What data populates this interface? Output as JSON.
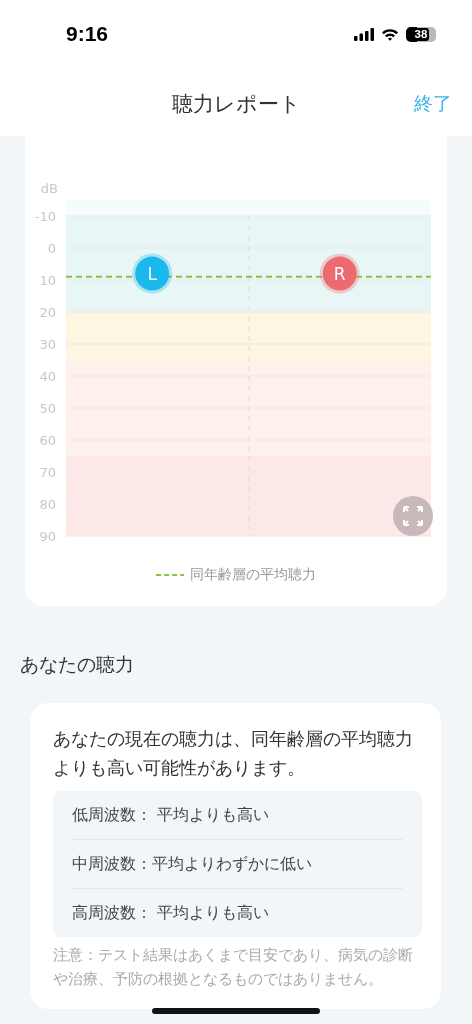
{
  "status_bar": {
    "time": "9:16",
    "battery": "38"
  },
  "header": {
    "title": "聴力レポート",
    "action": "終了"
  },
  "chart_card": {
    "chart_data": {
      "type": "scatter",
      "ylabel": "dB",
      "ylim": [
        90,
        -10
      ],
      "grid": true,
      "yticks": [
        -10,
        0,
        10,
        20,
        30,
        40,
        50,
        60,
        70,
        80,
        90
      ],
      "series": [
        {
          "name": "L",
          "color": "#1ab8ec",
          "values": [
            8
          ]
        },
        {
          "name": "R",
          "color": "#ec6a70",
          "values": [
            8
          ]
        }
      ],
      "bands": [
        {
          "axis": "y",
          "from": -10,
          "to": 20,
          "color": "#e8f6f5"
        },
        {
          "axis": "y",
          "from": 20,
          "to": 35,
          "color": "#fdf6e1"
        },
        {
          "axis": "y",
          "from": 35,
          "to": 65,
          "color": "#fef0ea"
        },
        {
          "axis": "y",
          "from": 65,
          "to": 90,
          "color": "#fde8e8"
        }
      ],
      "ref_lines": [
        {
          "axis": "y",
          "value": 9,
          "color": "#8dc04a",
          "label": "同年齢層の平均聴力"
        }
      ]
    }
  },
  "section_title": "あなたの聴力",
  "summary_card": {
    "text": "あなたの現在の聴力は、同年齢層の平均聴力よりも高い可能性があります。",
    "frequencies": [
      {
        "text": "低周波数： 平均よりも高い"
      },
      {
        "text": "中周波数：平均よりわずかに低い"
      },
      {
        "text": "高周波数： 平均よりも高い"
      }
    ],
    "note": "注意：テスト結果はあくまで目安であり、病気の診断や治療、予防の根拠となるものではありません。"
  }
}
